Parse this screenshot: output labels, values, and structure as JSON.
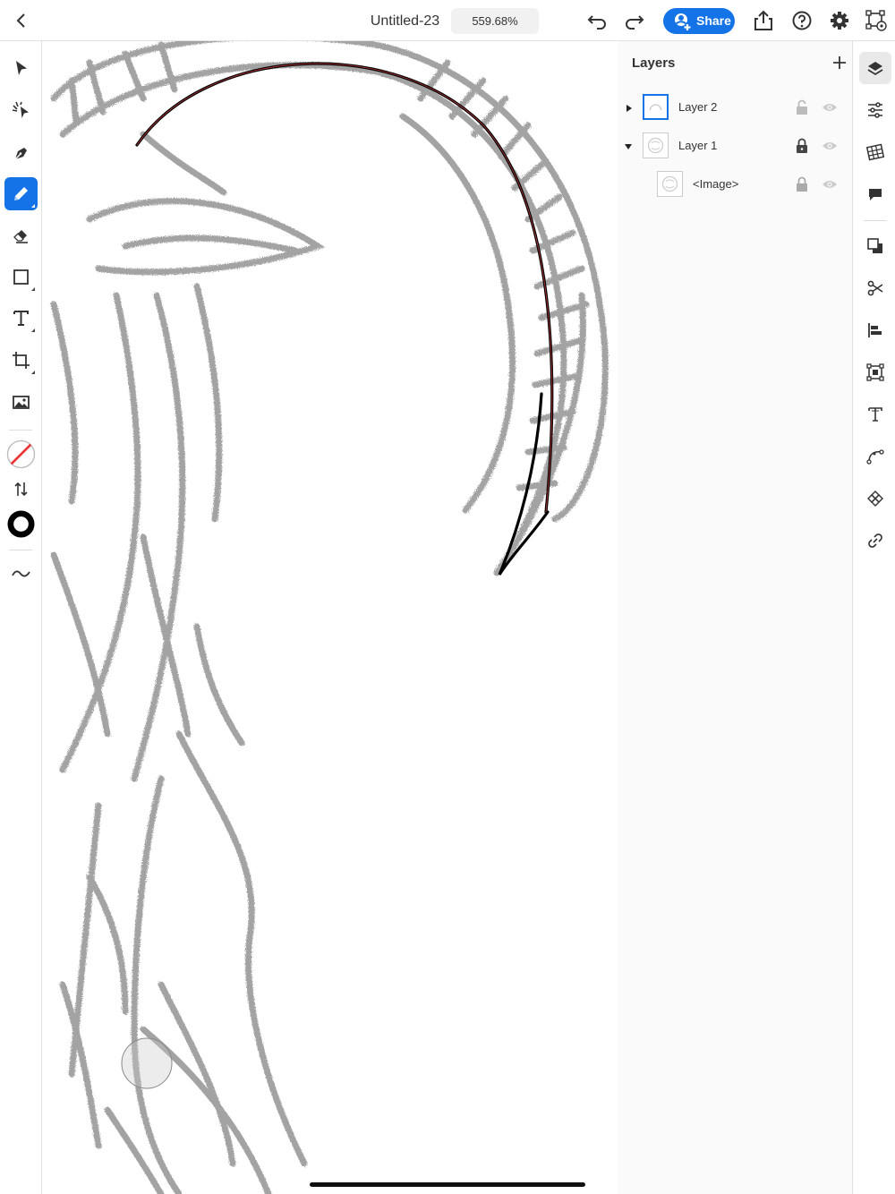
{
  "app": {
    "document_title": "Untitled-23",
    "zoom": "559.68%",
    "accent": "#1473e6"
  },
  "topbar": {
    "back_icon": "chevron-left-icon",
    "undo_icon": "undo-icon",
    "redo_icon": "redo-icon",
    "share_label": "Share",
    "share_icon": "add-person-icon",
    "export_icon": "export-icon",
    "help_icon": "help-icon",
    "settings_icon": "gear-icon",
    "plugins_icon": "plugins-icon"
  },
  "toolbar": {
    "tools": [
      "selection-tool",
      "direct-selection-tool",
      "pen-tool",
      "pencil-tool",
      "eraser-tool",
      "rectangle-tool",
      "type-tool",
      "crop-tool",
      "image-tool"
    ],
    "active_tool": "pencil-tool",
    "fill": "none",
    "stroke_color": "#000000"
  },
  "layers_panel": {
    "title": "Layers",
    "layers": [
      {
        "name": "Layer 2",
        "expanded": false,
        "selected": true,
        "locked": false
      },
      {
        "name": "Layer 1",
        "expanded": true,
        "selected": false,
        "locked": true
      },
      {
        "name": "<Image>",
        "expanded": false,
        "selected": false,
        "locked": true
      }
    ]
  },
  "right_panel": {
    "icons": [
      "layers-icon",
      "properties-icon",
      "swatches-icon",
      "comments-icon",
      "arrange-icon",
      "scissors-icon",
      "align-icon",
      "transform-icon",
      "text-icon",
      "path-icon",
      "repeat-icon",
      "link-icon"
    ],
    "active": "layers-icon"
  }
}
